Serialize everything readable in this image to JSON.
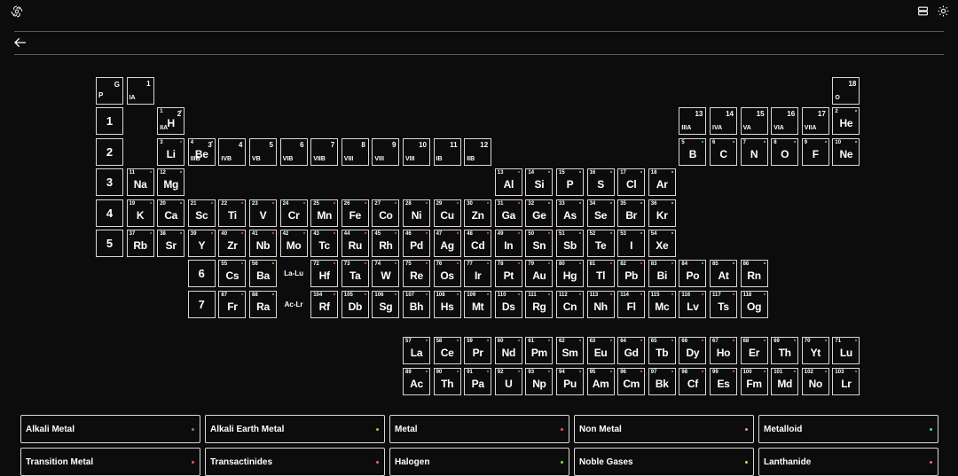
{
  "icons": {
    "logo": "openai-logo-icon",
    "layout": "layout-icon",
    "theme": "sun-icon",
    "back": "arrow-left-icon"
  },
  "colors": {
    "Alkali Metal": "#7f7f7f",
    "Alkali Earth Metal": "#9acd32",
    "Metal": "#ff4d4d",
    "Non Metal": "#ff8c8c",
    "Metalloid": "#40e0a0",
    "Transition Metal": "#ff5050",
    "Transactinides": "#ff5a5a",
    "Halogen": "#7dde5a",
    "Noble Gases": "#b8e05a",
    "Lanthanide": "#ff5a8a"
  },
  "key": {
    "g": "G",
    "p": "P"
  },
  "groups": [
    {
      "num": "1",
      "name": "IA"
    },
    {
      "num": "2",
      "name": "IIA"
    },
    {
      "num": "3",
      "name": "IIIB"
    },
    {
      "num": "4",
      "name": "IVB"
    },
    {
      "num": "5",
      "name": "VB"
    },
    {
      "num": "6",
      "name": "VIB"
    },
    {
      "num": "7",
      "name": "VIIB"
    },
    {
      "num": "8",
      "name": "VIII"
    },
    {
      "num": "9",
      "name": "VIII"
    },
    {
      "num": "10",
      "name": "VIII"
    },
    {
      "num": "11",
      "name": "IB"
    },
    {
      "num": "12",
      "name": "IIB"
    },
    {
      "num": "13",
      "name": "IIIA"
    },
    {
      "num": "14",
      "name": "IVA"
    },
    {
      "num": "15",
      "name": "VA"
    },
    {
      "num": "16",
      "name": "VIA"
    },
    {
      "num": "17",
      "name": "VIIA"
    },
    {
      "num": "18",
      "name": "O"
    }
  ],
  "periods": [
    "1",
    "2",
    "3",
    "4",
    "5",
    "6",
    "7"
  ],
  "ranges": {
    "lanthanides": "La-Lu",
    "actinides": "Ac-Lr"
  },
  "elements": [
    {
      "n": "1",
      "s": "H",
      "c": "Non Metal"
    },
    {
      "n": "2",
      "s": "He",
      "c": "Noble Gases"
    },
    {
      "n": "3",
      "s": "Li",
      "c": "Alkali Metal"
    },
    {
      "n": "4",
      "s": "Be",
      "c": "Alkali Earth Metal"
    },
    {
      "n": "5",
      "s": "B",
      "c": "Metalloid"
    },
    {
      "n": "6",
      "s": "C",
      "c": "Non Metal"
    },
    {
      "n": "7",
      "s": "N",
      "c": "Non Metal"
    },
    {
      "n": "8",
      "s": "O",
      "c": "Non Metal"
    },
    {
      "n": "9",
      "s": "F",
      "c": "Halogen"
    },
    {
      "n": "10",
      "s": "Ne",
      "c": "Noble Gases"
    },
    {
      "n": "11",
      "s": "Na",
      "c": "Alkali Metal"
    },
    {
      "n": "12",
      "s": "Mg",
      "c": "Alkali Earth Metal"
    },
    {
      "n": "13",
      "s": "Al",
      "c": "Metal"
    },
    {
      "n": "14",
      "s": "Si",
      "c": "Metalloid"
    },
    {
      "n": "15",
      "s": "P",
      "c": "Non Metal"
    },
    {
      "n": "16",
      "s": "S",
      "c": "Non Metal"
    },
    {
      "n": "17",
      "s": "Cl",
      "c": "Halogen"
    },
    {
      "n": "18",
      "s": "Ar",
      "c": "Noble Gases"
    },
    {
      "n": "19",
      "s": "K",
      "c": "Alkali Metal"
    },
    {
      "n": "20",
      "s": "Ca",
      "c": "Alkali Earth Metal"
    },
    {
      "n": "21",
      "s": "Sc",
      "c": "Transition Metal"
    },
    {
      "n": "22",
      "s": "Ti",
      "c": "Transition Metal"
    },
    {
      "n": "23",
      "s": "V",
      "c": "Transition Metal"
    },
    {
      "n": "24",
      "s": "Cr",
      "c": "Transition Metal"
    },
    {
      "n": "25",
      "s": "Mn",
      "c": "Transition Metal"
    },
    {
      "n": "26",
      "s": "Fe",
      "c": "Transition Metal"
    },
    {
      "n": "27",
      "s": "Co",
      "c": "Transition Metal"
    },
    {
      "n": "28",
      "s": "Ni",
      "c": "Transition Metal"
    },
    {
      "n": "29",
      "s": "Cu",
      "c": "Transition Metal"
    },
    {
      "n": "30",
      "s": "Zn",
      "c": "Transition Metal"
    },
    {
      "n": "31",
      "s": "Ga",
      "c": "Metal"
    },
    {
      "n": "32",
      "s": "Ge",
      "c": "Metalloid"
    },
    {
      "n": "33",
      "s": "As",
      "c": "Metalloid"
    },
    {
      "n": "34",
      "s": "Se",
      "c": "Non Metal"
    },
    {
      "n": "35",
      "s": "Br",
      "c": "Halogen"
    },
    {
      "n": "36",
      "s": "Kr",
      "c": "Noble Gases"
    },
    {
      "n": "37",
      "s": "Rb",
      "c": "Alkali Metal"
    },
    {
      "n": "38",
      "s": "Sr",
      "c": "Alkali Earth Metal"
    },
    {
      "n": "39",
      "s": "Y",
      "c": "Transition Metal"
    },
    {
      "n": "40",
      "s": "Zr",
      "c": "Transition Metal"
    },
    {
      "n": "41",
      "s": "Nb",
      "c": "Transition Metal"
    },
    {
      "n": "42",
      "s": "Mo",
      "c": "Transition Metal"
    },
    {
      "n": "43",
      "s": "Tc",
      "c": "Transition Metal"
    },
    {
      "n": "44",
      "s": "Ru",
      "c": "Transition Metal"
    },
    {
      "n": "45",
      "s": "Rh",
      "c": "Transition Metal"
    },
    {
      "n": "46",
      "s": "Pd",
      "c": "Transition Metal"
    },
    {
      "n": "47",
      "s": "Ag",
      "c": "Transition Metal"
    },
    {
      "n": "48",
      "s": "Cd",
      "c": "Transition Metal"
    },
    {
      "n": "49",
      "s": "In",
      "c": "Metal"
    },
    {
      "n": "50",
      "s": "Sn",
      "c": "Metal"
    },
    {
      "n": "51",
      "s": "Sb",
      "c": "Metalloid"
    },
    {
      "n": "52",
      "s": "Te",
      "c": "Metalloid"
    },
    {
      "n": "53",
      "s": "I",
      "c": "Halogen"
    },
    {
      "n": "54",
      "s": "Xe",
      "c": "Noble Gases"
    },
    {
      "n": "55",
      "s": "Cs",
      "c": "Alkali Metal"
    },
    {
      "n": "56",
      "s": "Ba",
      "c": "Alkali Earth Metal"
    },
    {
      "n": "72",
      "s": "Hf",
      "c": "Transition Metal"
    },
    {
      "n": "73",
      "s": "Ta",
      "c": "Transition Metal"
    },
    {
      "n": "74",
      "s": "W",
      "c": "Transition Metal"
    },
    {
      "n": "75",
      "s": "Re",
      "c": "Transition Metal"
    },
    {
      "n": "76",
      "s": "Os",
      "c": "Transition Metal"
    },
    {
      "n": "77",
      "s": "Ir",
      "c": "Transition Metal"
    },
    {
      "n": "78",
      "s": "Pt",
      "c": "Transition Metal"
    },
    {
      "n": "79",
      "s": "Au",
      "c": "Transition Metal"
    },
    {
      "n": "80",
      "s": "Hg",
      "c": "Transition Metal"
    },
    {
      "n": "81",
      "s": "Tl",
      "c": "Metal"
    },
    {
      "n": "82",
      "s": "Pb",
      "c": "Metal"
    },
    {
      "n": "83",
      "s": "Bi",
      "c": "Metal"
    },
    {
      "n": "84",
      "s": "Po",
      "c": "Metalloid"
    },
    {
      "n": "85",
      "s": "At",
      "c": "Halogen"
    },
    {
      "n": "86",
      "s": "Rn",
      "c": "Noble Gases"
    },
    {
      "n": "87",
      "s": "Fr",
      "c": "Alkali Metal"
    },
    {
      "n": "88",
      "s": "Ra",
      "c": "Alkali Earth Metal"
    },
    {
      "n": "104",
      "s": "Rf",
      "c": "Transactinides"
    },
    {
      "n": "105",
      "s": "Db",
      "c": "Transactinides"
    },
    {
      "n": "106",
      "s": "Sg",
      "c": "Transactinides"
    },
    {
      "n": "107",
      "s": "Bh",
      "c": "Transactinides"
    },
    {
      "n": "108",
      "s": "Hs",
      "c": "Transactinides"
    },
    {
      "n": "109",
      "s": "Mt",
      "c": "Transactinides"
    },
    {
      "n": "110",
      "s": "Ds",
      "c": "Transactinides"
    },
    {
      "n": "111",
      "s": "Rg",
      "c": "Transactinides"
    },
    {
      "n": "112",
      "s": "Cn",
      "c": "Transactinides"
    },
    {
      "n": "113",
      "s": "Nh",
      "c": "Transactinides"
    },
    {
      "n": "114",
      "s": "Fl",
      "c": "Transactinides"
    },
    {
      "n": "115",
      "s": "Mc",
      "c": "Transactinides"
    },
    {
      "n": "116",
      "s": "Lv",
      "c": "Transactinides"
    },
    {
      "n": "117",
      "s": "Ts",
      "c": "Transactinides"
    },
    {
      "n": "118",
      "s": "Og",
      "c": "Transactinides"
    },
    {
      "n": "57",
      "s": "La",
      "c": "Lanthanide"
    },
    {
      "n": "58",
      "s": "Ce",
      "c": "Lanthanide"
    },
    {
      "n": "59",
      "s": "Pr",
      "c": "Lanthanide"
    },
    {
      "n": "60",
      "s": "Nd",
      "c": "Lanthanide"
    },
    {
      "n": "61",
      "s": "Pm",
      "c": "Lanthanide"
    },
    {
      "n": "62",
      "s": "Sm",
      "c": "Lanthanide"
    },
    {
      "n": "63",
      "s": "Eu",
      "c": "Lanthanide"
    },
    {
      "n": "64",
      "s": "Gd",
      "c": "Lanthanide"
    },
    {
      "n": "65",
      "s": "Tb",
      "c": "Lanthanide"
    },
    {
      "n": "66",
      "s": "Dy",
      "c": "Lanthanide"
    },
    {
      "n": "67",
      "s": "Ho",
      "c": "Lanthanide"
    },
    {
      "n": "68",
      "s": "Er",
      "c": "Lanthanide"
    },
    {
      "n": "69",
      "s": "Th",
      "c": "Lanthanide"
    },
    {
      "n": "70",
      "s": "Yt",
      "c": "Lanthanide"
    },
    {
      "n": "71",
      "s": "Lu",
      "c": "Lanthanide"
    },
    {
      "n": "89",
      "s": "Ac",
      "c": "Lanthanide"
    },
    {
      "n": "90",
      "s": "Th",
      "c": "Lanthanide"
    },
    {
      "n": "91",
      "s": "Pa",
      "c": "Lanthanide"
    },
    {
      "n": "92",
      "s": "U",
      "c": "Lanthanide"
    },
    {
      "n": "93",
      "s": "Np",
      "c": "Lanthanide"
    },
    {
      "n": "94",
      "s": "Pu",
      "c": "Lanthanide"
    },
    {
      "n": "95",
      "s": "Am",
      "c": "Lanthanide"
    },
    {
      "n": "96",
      "s": "Cm",
      "c": "Lanthanide"
    },
    {
      "n": "97",
      "s": "Bk",
      "c": "Lanthanide"
    },
    {
      "n": "98",
      "s": "Cf",
      "c": "Lanthanide"
    },
    {
      "n": "99",
      "s": "Es",
      "c": "Lanthanide"
    },
    {
      "n": "100",
      "s": "Fm",
      "c": "Lanthanide"
    },
    {
      "n": "101",
      "s": "Md",
      "c": "Lanthanide"
    },
    {
      "n": "102",
      "s": "No",
      "c": "Lanthanide"
    },
    {
      "n": "103",
      "s": "Lr",
      "c": "Lanthanide"
    }
  ],
  "legend": [
    "Alkali Metal",
    "Alkali Earth Metal",
    "Metal",
    "Non Metal",
    "Metalloid",
    "Transition Metal",
    "Transactinides",
    "Halogen",
    "Noble Gases",
    "Lanthanide"
  ]
}
